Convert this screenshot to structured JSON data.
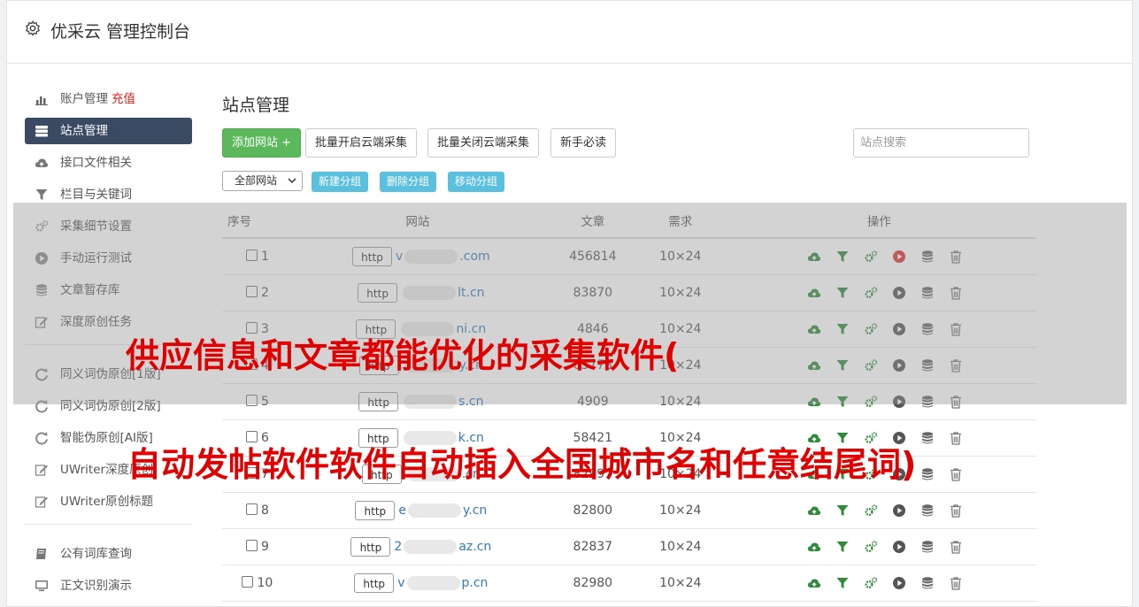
{
  "app_title": "优采云 管理控制台",
  "sidebar": {
    "items": [
      {
        "label": "账户管理",
        "extra": "充值",
        "icon": "bar-chart-icon"
      },
      {
        "label": "站点管理",
        "icon": "server-icon",
        "active": true
      },
      {
        "label": "接口文件相关",
        "icon": "cloud-upload-icon"
      },
      {
        "label": "栏目与关键词",
        "icon": "filter-icon"
      },
      {
        "label": "采集细节设置",
        "icon": "cogs-icon"
      },
      {
        "label": "手动运行测试",
        "icon": "play-icon"
      },
      {
        "label": "文章暂存库",
        "icon": "database-icon"
      },
      {
        "label": "深度原创任务",
        "icon": "edit-icon"
      }
    ],
    "items2": [
      {
        "label": "同义词伪原创[1版]",
        "icon": "refresh-icon"
      },
      {
        "label": "同义词伪原创[2版]",
        "icon": "refresh-icon"
      },
      {
        "label": "智能伪原创[AI版]",
        "icon": "refresh-icon"
      },
      {
        "label": "UWriter深度原创",
        "icon": "edit-icon"
      },
      {
        "label": "UWriter原创标题",
        "icon": "edit-icon"
      }
    ],
    "items3": [
      {
        "label": "公有词库查询",
        "icon": "book-icon"
      },
      {
        "label": "正文识别演示",
        "icon": "monitor-icon"
      }
    ]
  },
  "main": {
    "title": "站点管理",
    "add_button": "添加网站 +",
    "batch_on_button": "批量开启云端采集",
    "batch_off_button": "批量关闭云端采集",
    "guide_button": "新手必读",
    "search_placeholder": "站点搜索",
    "group_select": "全部网站",
    "new_group": "新建分组",
    "delete_group": "删除分组",
    "move_group": "移动分组"
  },
  "table": {
    "headers": [
      "序号",
      "网站",
      "文章",
      "需求",
      "操作"
    ],
    "rows": [
      {
        "num": "1",
        "prefix": "v",
        "suffix": ".com",
        "articles": "456814",
        "demand": "10×24",
        "play_color": "#e03030"
      },
      {
        "num": "2",
        "prefix": "",
        "suffix": "lt.cn",
        "articles": "83870",
        "demand": "10×24",
        "play_color": "#555555"
      },
      {
        "num": "3",
        "prefix": "",
        "suffix": "ni.cn",
        "articles": "4846",
        "demand": "10×24",
        "play_color": "#555555"
      },
      {
        "num": "4",
        "prefix": "",
        "suffix": "y.cn",
        "articles": "63778",
        "demand": "10×24",
        "play_color": "#555555"
      },
      {
        "num": "5",
        "prefix": "",
        "suffix": "s.cn",
        "articles": "4909",
        "demand": "10×24",
        "play_color": "#555555"
      },
      {
        "num": "6",
        "prefix": "",
        "suffix": "k.cn",
        "articles": "58421",
        "demand": "10×24",
        "play_color": "#555555"
      },
      {
        "num": "7",
        "prefix": "",
        "suffix": ".cn",
        "articles": "82997",
        "demand": "10×24",
        "play_color": "#555555"
      },
      {
        "num": "8",
        "prefix": "e",
        "suffix": "y.cn",
        "articles": "82800",
        "demand": "10×24",
        "play_color": "#555555"
      },
      {
        "num": "9",
        "prefix": "2",
        "suffix": "az.cn",
        "articles": "82837",
        "demand": "10×24",
        "play_color": "#555555"
      },
      {
        "num": "10",
        "prefix": "v",
        "suffix": "p.cn",
        "articles": "82980",
        "demand": "10×24",
        "play_color": "#555555"
      }
    ],
    "http_label": "http"
  },
  "overlay": {
    "line1": "供应信息和文章都能优化的采集软件(",
    "line2": "自动发帖软件软件自动插入全国城市名和任意结尾词)"
  },
  "colors": {
    "accent_green": "#5cb85c",
    "info_blue": "#5bc0de",
    "link_blue": "#337ab7",
    "active_nav": "#3b4a63",
    "caption_red": "#e00000"
  }
}
